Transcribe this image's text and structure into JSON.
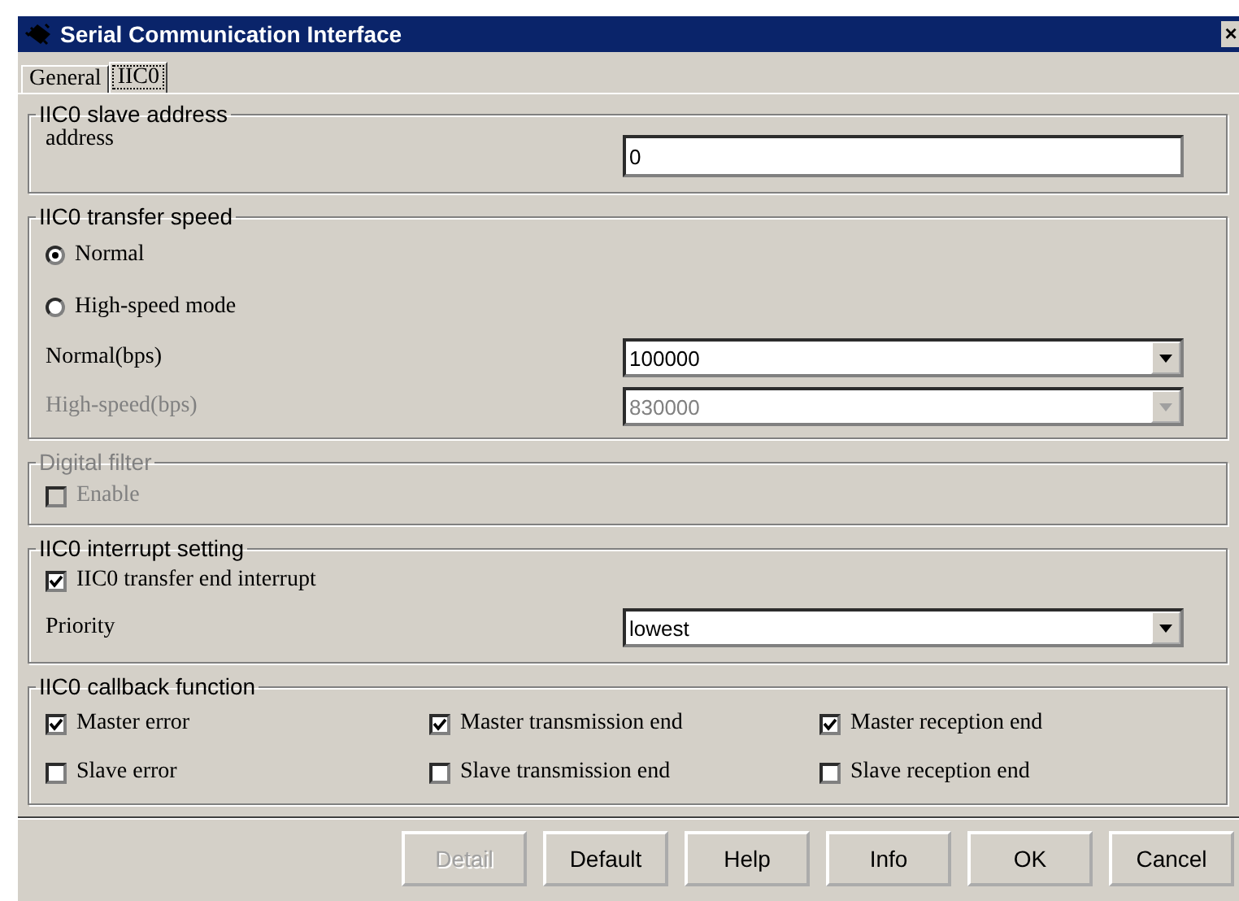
{
  "window": {
    "title": "Serial Communication Interface",
    "close": "×"
  },
  "tabs": [
    {
      "label": "General",
      "selected": false
    },
    {
      "label": "IIC0",
      "selected": true
    }
  ],
  "slave_address": {
    "title": "IIC0 slave address",
    "label": "address",
    "value": "0"
  },
  "transfer_speed": {
    "title": "IIC0 transfer speed",
    "modes": [
      {
        "label": "Normal",
        "selected": true
      },
      {
        "label": "High-speed mode",
        "selected": false
      }
    ],
    "speeds": [
      {
        "label": "Normal(bps)",
        "value": "100000",
        "disabled": false
      },
      {
        "label": "High-speed(bps)",
        "value": "830000",
        "disabled": true
      }
    ]
  },
  "digital_filter": {
    "title": "Digital filter",
    "disabled": true,
    "enable": {
      "label": "Enable",
      "checked": false
    }
  },
  "interrupt": {
    "title": "IIC0 interrupt setting",
    "transfer_end": {
      "label": "IIC0 transfer end interrupt",
      "checked": true
    },
    "priority": {
      "label": "Priority",
      "value": "lowest"
    }
  },
  "callback": {
    "title": "IIC0 callback function",
    "items": [
      {
        "label": "Master error",
        "checked": true
      },
      {
        "label": "Master transmission end",
        "checked": true
      },
      {
        "label": "Master reception end",
        "checked": true
      },
      {
        "label": "Slave error",
        "checked": false
      },
      {
        "label": "Slave transmission end",
        "checked": false
      },
      {
        "label": "Slave reception end",
        "checked": false
      }
    ]
  },
  "buttons": [
    {
      "label": "Detail",
      "disabled": true
    },
    {
      "label": "Default",
      "disabled": false
    },
    {
      "label": "Help",
      "disabled": false
    },
    {
      "label": "Info",
      "disabled": false
    },
    {
      "label": "OK",
      "disabled": false
    },
    {
      "label": "Cancel",
      "disabled": false
    }
  ]
}
